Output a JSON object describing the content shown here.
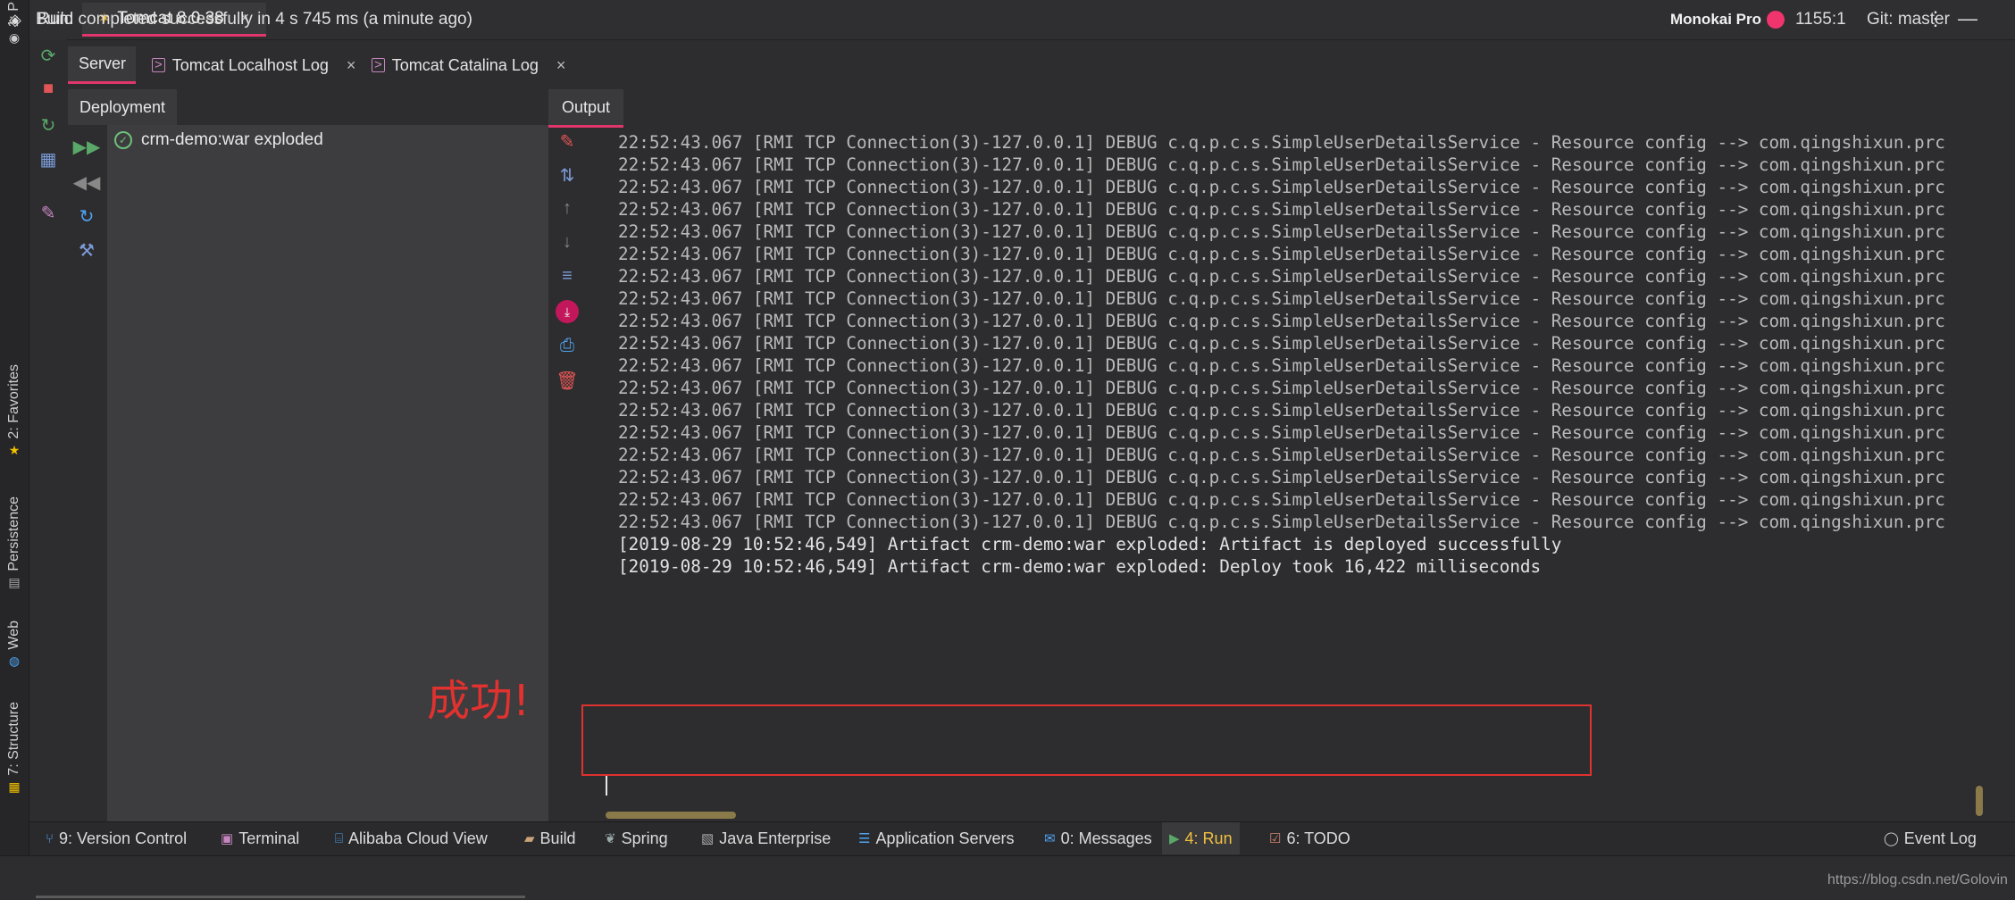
{
  "left_strip": {
    "tabs": [
      {
        "label": "1: P",
        "icon": "project-icon"
      },
      {
        "label": "2: Favorites",
        "icon": "star-icon"
      },
      {
        "label": "Persistence",
        "icon": "persistence-icon"
      },
      {
        "label": "Web",
        "icon": "globe-icon"
      },
      {
        "label": "7: Structure",
        "icon": "structure-icon"
      }
    ]
  },
  "run_header": {
    "label": "Run:",
    "tab_label": "Tomcat 8.0.38",
    "close": "×",
    "menu": "⋮",
    "minimize": "—"
  },
  "sub_tabs": {
    "server": "Server",
    "localhost_log": "Tomcat Localhost Log",
    "catalina_log": "Tomcat Catalina Log",
    "close": "×"
  },
  "deployment": {
    "header": "Deployment",
    "items": [
      "crm-demo:war exploded"
    ]
  },
  "annotation": {
    "text": "成功!"
  },
  "output": {
    "header": "Output",
    "debug_lines": [
      "22:52:43.067 [RMI TCP Connection(3)-127.0.0.1] DEBUG c.q.p.c.s.SimpleUserDetailsService - Resource config --> com.qingshixun.prc",
      "22:52:43.067 [RMI TCP Connection(3)-127.0.0.1] DEBUG c.q.p.c.s.SimpleUserDetailsService - Resource config --> com.qingshixun.prc",
      "22:52:43.067 [RMI TCP Connection(3)-127.0.0.1] DEBUG c.q.p.c.s.SimpleUserDetailsService - Resource config --> com.qingshixun.prc",
      "22:52:43.067 [RMI TCP Connection(3)-127.0.0.1] DEBUG c.q.p.c.s.SimpleUserDetailsService - Resource config --> com.qingshixun.prc",
      "22:52:43.067 [RMI TCP Connection(3)-127.0.0.1] DEBUG c.q.p.c.s.SimpleUserDetailsService - Resource config --> com.qingshixun.prc",
      "22:52:43.067 [RMI TCP Connection(3)-127.0.0.1] DEBUG c.q.p.c.s.SimpleUserDetailsService - Resource config --> com.qingshixun.prc",
      "22:52:43.067 [RMI TCP Connection(3)-127.0.0.1] DEBUG c.q.p.c.s.SimpleUserDetailsService - Resource config --> com.qingshixun.prc",
      "22:52:43.067 [RMI TCP Connection(3)-127.0.0.1] DEBUG c.q.p.c.s.SimpleUserDetailsService - Resource config --> com.qingshixun.prc",
      "22:52:43.067 [RMI TCP Connection(3)-127.0.0.1] DEBUG c.q.p.c.s.SimpleUserDetailsService - Resource config --> com.qingshixun.prc",
      "22:52:43.067 [RMI TCP Connection(3)-127.0.0.1] DEBUG c.q.p.c.s.SimpleUserDetailsService - Resource config --> com.qingshixun.prc",
      "22:52:43.067 [RMI TCP Connection(3)-127.0.0.1] DEBUG c.q.p.c.s.SimpleUserDetailsService - Resource config --> com.qingshixun.prc",
      "22:52:43.067 [RMI TCP Connection(3)-127.0.0.1] DEBUG c.q.p.c.s.SimpleUserDetailsService - Resource config --> com.qingshixun.prc",
      "22:52:43.067 [RMI TCP Connection(3)-127.0.0.1] DEBUG c.q.p.c.s.SimpleUserDetailsService - Resource config --> com.qingshixun.prc",
      "22:52:43.067 [RMI TCP Connection(3)-127.0.0.1] DEBUG c.q.p.c.s.SimpleUserDetailsService - Resource config --> com.qingshixun.prc",
      "22:52:43.067 [RMI TCP Connection(3)-127.0.0.1] DEBUG c.q.p.c.s.SimpleUserDetailsService - Resource config --> com.qingshixun.prc",
      "22:52:43.067 [RMI TCP Connection(3)-127.0.0.1] DEBUG c.q.p.c.s.SimpleUserDetailsService - Resource config --> com.qingshixun.prc",
      "22:52:43.067 [RMI TCP Connection(3)-127.0.0.1] DEBUG c.q.p.c.s.SimpleUserDetailsService - Resource config --> com.qingshixun.prc",
      "22:52:43.067 [RMI TCP Connection(3)-127.0.0.1] DEBUG c.q.p.c.s.SimpleUserDetailsService - Resource config --> com.qingshixun.prc"
    ],
    "success_lines": [
      "[2019-08-29 10:52:46,549] Artifact crm-demo:war exploded: Artifact is deployed successfully",
      "[2019-08-29 10:52:46,549] Artifact crm-demo:war exploded: Deploy took 16,422 milliseconds"
    ]
  },
  "bottom_bar": {
    "tabs": [
      {
        "label": "9: Version Control",
        "icon": "branch-icon"
      },
      {
        "label": "Terminal",
        "icon": "terminal-icon"
      },
      {
        "label": "Alibaba Cloud View",
        "icon": "cloud-icon"
      },
      {
        "label": "Build",
        "icon": "build-icon"
      },
      {
        "label": "Spring",
        "icon": "spring-icon"
      },
      {
        "label": "Java Enterprise",
        "icon": "java-enterprise-icon"
      },
      {
        "label": "Application Servers",
        "icon": "servers-icon"
      },
      {
        "label": "0: Messages",
        "icon": "messages-icon"
      },
      {
        "label": "4: Run",
        "icon": "run-icon"
      },
      {
        "label": "6: TODO",
        "icon": "todo-icon"
      }
    ],
    "event_log": "Event Log"
  },
  "status_bar": {
    "message": "Build completed successfully in 4 s 745 ms (a minute ago)",
    "theme": "Monokai Pro",
    "caret": "1155:1",
    "git": "Git: master",
    "watermark": "https://blog.csdn.net/Golovin"
  },
  "colors": {
    "accent": "#e0366c",
    "annotation": "#e0322f",
    "success_check": "#6ec07a"
  }
}
